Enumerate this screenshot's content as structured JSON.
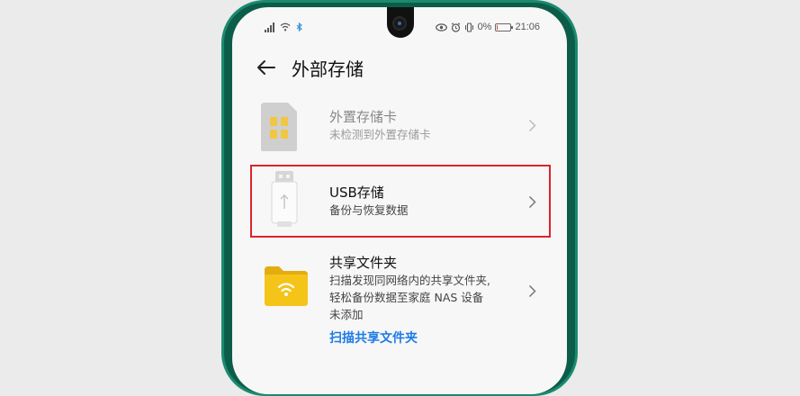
{
  "status_bar": {
    "left_text": "⁴⁶ᴴᴰ",
    "right_percent": "0%",
    "time": "21:06",
    "battery_level": 0.0
  },
  "header": {
    "title": "外部存储"
  },
  "items": [
    {
      "title": "外置存储卡",
      "subtitle": "未检测到外置存储卡",
      "enabled": false
    },
    {
      "title": "USB存储",
      "subtitle": "备份与恢复数据",
      "enabled": true
    },
    {
      "title": "共享文件夹",
      "subtitle_lines": [
        "扫描发现同网络内的共享文件夹,",
        "轻松备份数据至家庭 NAS 设备",
        "未添加"
      ],
      "link": "扫描共享文件夹",
      "enabled": true
    }
  ],
  "colors": {
    "accent": "#1e7be6",
    "highlight_box": "#d9262b",
    "folder": "#f5c419",
    "frame": "#0b5d4a"
  },
  "icons": [
    "back-arrow-icon",
    "sim-card-icon",
    "usb-drive-icon",
    "shared-folder-icon",
    "chevron-right-icon"
  ]
}
